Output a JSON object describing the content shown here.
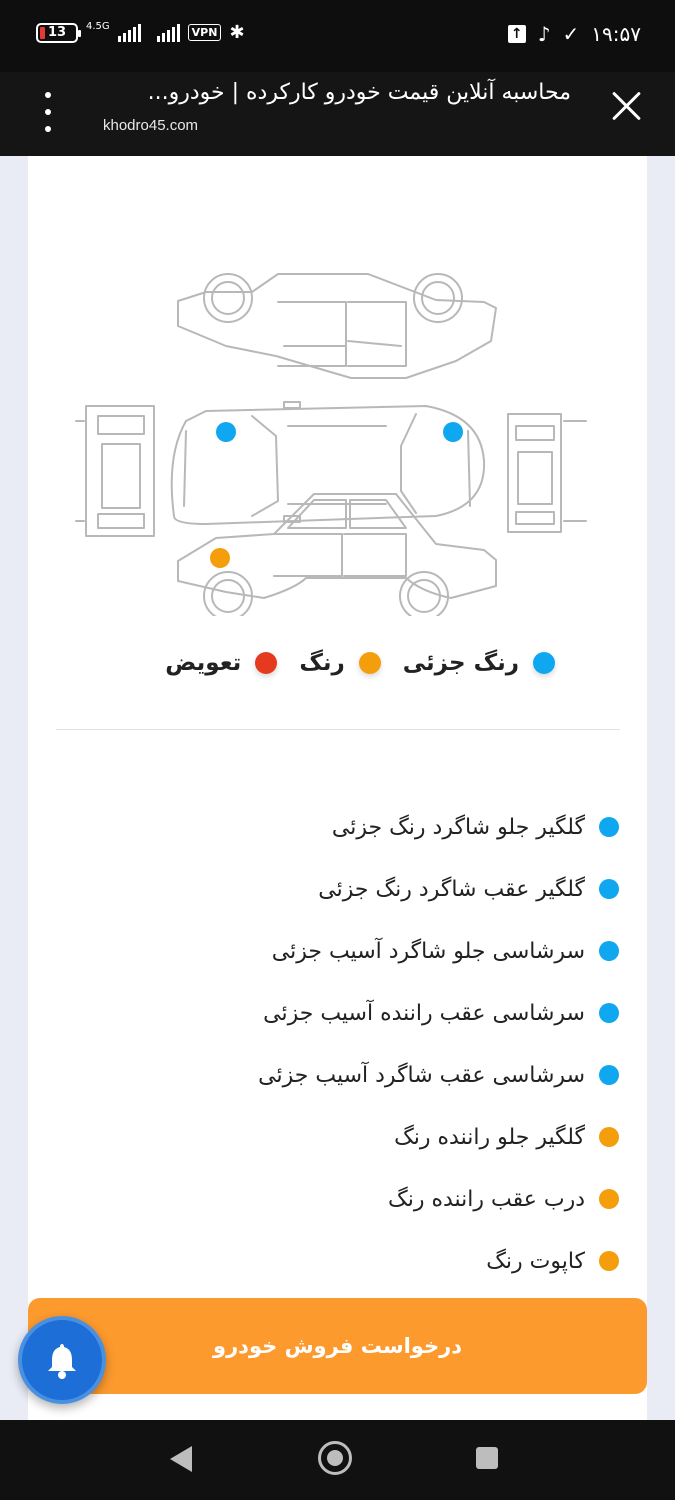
{
  "status_bar": {
    "battery": "13",
    "network": "4.5G",
    "vpn": "VPN",
    "time": "۱۹:۵۷"
  },
  "browser": {
    "title": "محاسبه آنلاین قیمت خودرو کارکرده | خودرو...",
    "domain": "khodro45.com"
  },
  "legend": [
    {
      "label": "رنگ جزئی",
      "color": "#0ea7f0"
    },
    {
      "label": "رنگ",
      "color": "#f59e0b"
    },
    {
      "label": "تعویض",
      "color": "#e53a1e"
    }
  ],
  "damage_items": [
    {
      "text": "گلگیر جلو شاگرد رنگ جزئی",
      "color": "#0ea7f0"
    },
    {
      "text": "گلگیر عقب شاگرد رنگ جزئی",
      "color": "#0ea7f0"
    },
    {
      "text": "سرشاسی جلو شاگرد آسیب جزئی",
      "color": "#0ea7f0"
    },
    {
      "text": "سرشاسی عقب راننده آسیب جزئی",
      "color": "#0ea7f0"
    },
    {
      "text": "سرشاسی عقب شاگرد آسیب جزئی",
      "color": "#0ea7f0"
    },
    {
      "text": "گلگیر جلو راننده رنگ",
      "color": "#f59e0b"
    },
    {
      "text": "درب عقب راننده رنگ",
      "color": "#f59e0b"
    },
    {
      "text": "کاپوت رنگ",
      "color": "#f59e0b"
    }
  ],
  "sell_button": "درخواست فروش خودرو",
  "colors": {
    "accent": "#fd9a2e",
    "partial_paint": "#0ea7f0",
    "paint": "#f59e0b",
    "replace": "#e53a1e",
    "fab": "#1d6ed6"
  }
}
